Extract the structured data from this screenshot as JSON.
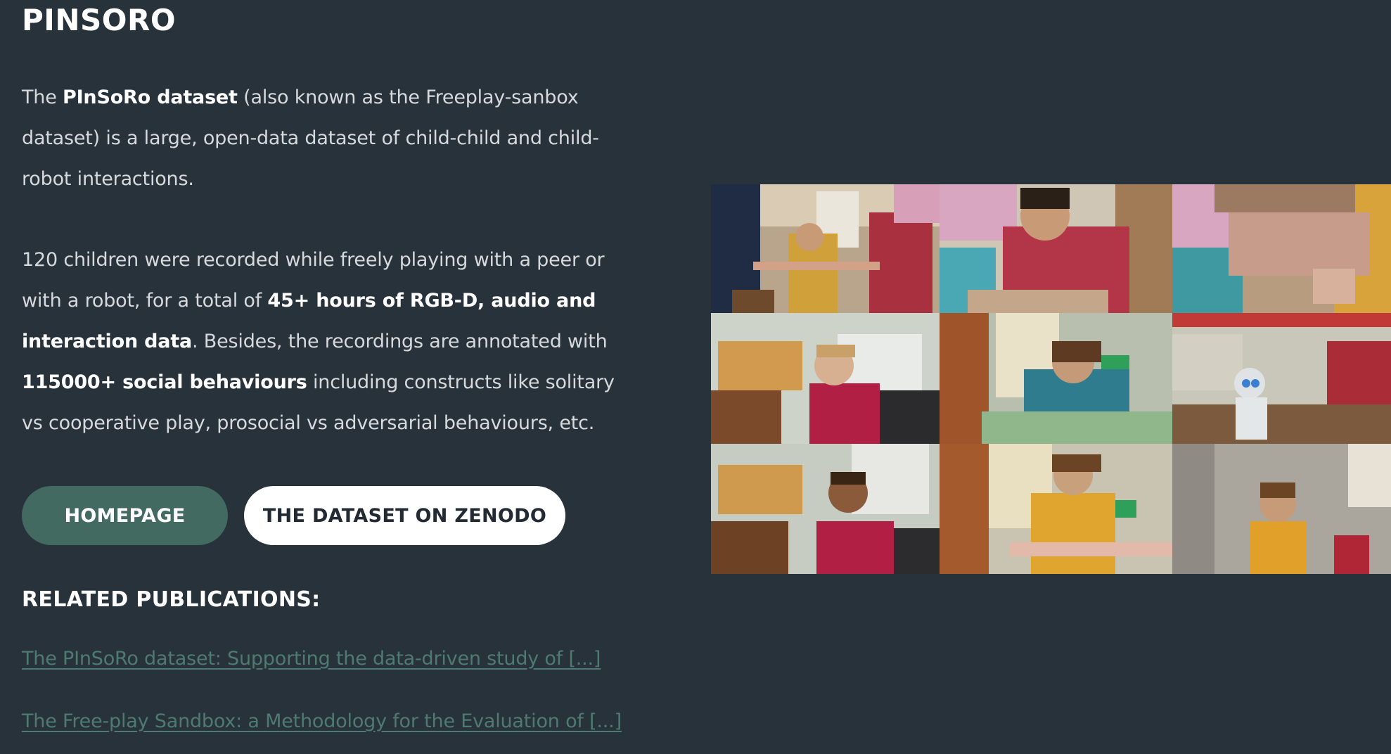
{
  "page": {
    "title": "PINSORO"
  },
  "intro": {
    "p1_pre": "The ",
    "p1_bold": "PInSoRo dataset",
    "p1_post": " (also known as the Freeplay-sanbox dataset) is a large, open-data dataset of child-child and child-robot interactions.",
    "p2_pre": "120 children were recorded while freely playing with a peer or with a robot, for a total of ",
    "p2_bold1": "45+ hours of RGB-D, audio and interaction data",
    "p2_mid": ". Besides, the recordings are annotated with ",
    "p2_bold2": "115000+ social behaviours",
    "p2_post": " including constructs like solitary vs cooperative play, prosocial vs adversarial behaviours, etc."
  },
  "buttons": {
    "homepage": "HOMEPAGE",
    "zenodo": "THE DATASET ON ZENODO"
  },
  "publications": {
    "heading": "RELATED PUBLICATIONS:",
    "items": [
      "The PInSoRo dataset: Supporting the data-driven study of [...]",
      "The Free-play Sandbox: a Methodology for the Evaluation of [...]"
    ]
  },
  "colors": {
    "background": "#28323b",
    "accent": "#426a60",
    "link": "#4e7a71"
  }
}
